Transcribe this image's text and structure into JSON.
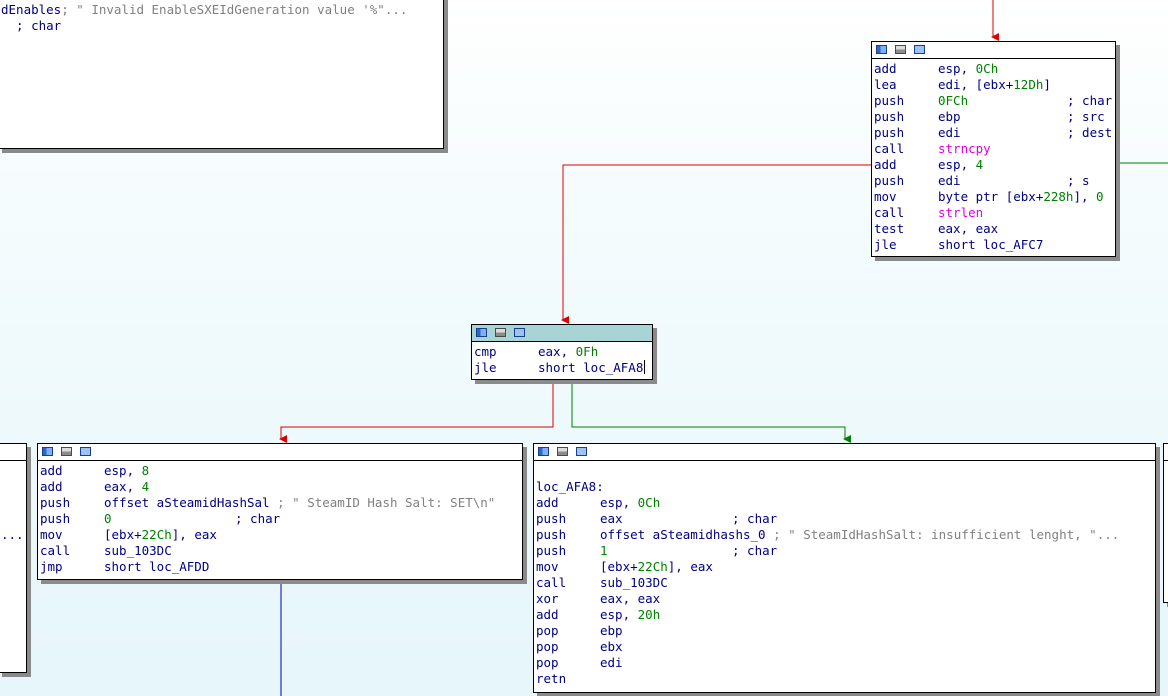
{
  "colors": {
    "true_edge": "#008000",
    "false_edge": "#e00000",
    "jump_edge": "#0000c0",
    "operand": "#000080",
    "number": "#008000",
    "function": "#e000e0",
    "comment": "#808080"
  },
  "nodes": {
    "top_left": {
      "lines": [
        {
          "m": "dEnables",
          "op": "",
          "comment": "; \" Invalid EnableSXEIdGeneration value '%\"..."
        },
        {
          "m": "",
          "op": "",
          "comment": "  ; char"
        }
      ]
    },
    "top_right": {
      "lines": [
        {
          "m": "add",
          "parts": [
            {
              "t": "esp, "
            },
            {
              "t": "0Ch",
              "c": "n"
            }
          ]
        },
        {
          "m": "lea",
          "parts": [
            {
              "t": "edi, [ebx+"
            },
            {
              "t": "12Dh",
              "c": "n"
            },
            {
              "t": "]"
            }
          ]
        },
        {
          "m": "push",
          "parts": [
            {
              "t": "0FCh",
              "c": "n"
            }
          ],
          "comment": "; char"
        },
        {
          "m": "push",
          "parts": [
            {
              "t": "ebp"
            }
          ],
          "comment": "; src"
        },
        {
          "m": "push",
          "parts": [
            {
              "t": "edi"
            }
          ],
          "comment": "; dest"
        },
        {
          "m": "call",
          "parts": [
            {
              "t": "strncpy",
              "c": "f"
            }
          ]
        },
        {
          "m": "add",
          "parts": [
            {
              "t": "esp, "
            },
            {
              "t": "4",
              "c": "n"
            }
          ]
        },
        {
          "m": "push",
          "parts": [
            {
              "t": "edi"
            }
          ],
          "comment": "; s"
        },
        {
          "m": "mov",
          "parts": [
            {
              "t": "byte ptr [ebx+"
            },
            {
              "t": "228h",
              "c": "n"
            },
            {
              "t": "], "
            },
            {
              "t": "0",
              "c": "n"
            }
          ]
        },
        {
          "m": "call",
          "parts": [
            {
              "t": "strlen",
              "c": "f"
            }
          ]
        },
        {
          "m": "test",
          "parts": [
            {
              "t": "eax, eax"
            }
          ]
        },
        {
          "m": "jle",
          "parts": [
            {
              "t": "short loc_AFC7"
            }
          ]
        }
      ]
    },
    "middle": {
      "lines": [
        {
          "m": "cmp",
          "parts": [
            {
              "t": "eax, "
            },
            {
              "t": "0Fh",
              "c": "n"
            }
          ]
        },
        {
          "m": "jle",
          "parts": [
            {
              "t": "short loc_AFA8"
            }
          ]
        }
      ]
    },
    "bottom_left": {
      "lines": [
        {
          "m": "add",
          "parts": [
            {
              "t": "esp, "
            },
            {
              "t": "8",
              "c": "n"
            }
          ]
        },
        {
          "m": "add",
          "parts": [
            {
              "t": "eax, "
            },
            {
              "t": "4",
              "c": "n"
            }
          ]
        },
        {
          "m": "push",
          "parts": [
            {
              "t": "offset aSteamidHashSal "
            }
          ],
          "comment": "; \" SteamID Hash Salt: SET\\n\""
        },
        {
          "m": "push",
          "parts": [
            {
              "t": "0",
              "c": "n"
            }
          ],
          "comment": "; char"
        },
        {
          "m": "mov",
          "parts": [
            {
              "t": "[ebx+"
            },
            {
              "t": "22Ch",
              "c": "n"
            },
            {
              "t": "], eax"
            }
          ]
        },
        {
          "m": "call",
          "parts": [
            {
              "t": "sub_103DC"
            }
          ]
        },
        {
          "m": "jmp",
          "parts": [
            {
              "t": "short loc_AFDD"
            }
          ]
        }
      ]
    },
    "bottom_right": {
      "lines": [
        {
          "m": "",
          "parts": []
        },
        {
          "m": "loc_AFA8:",
          "parts": []
        },
        {
          "m": "add",
          "parts": [
            {
              "t": "esp, "
            },
            {
              "t": "0Ch",
              "c": "n"
            }
          ]
        },
        {
          "m": "push",
          "parts": [
            {
              "t": "eax"
            }
          ],
          "comment": "; char"
        },
        {
          "m": "push",
          "parts": [
            {
              "t": "offset aSteamidhashs_0 "
            }
          ],
          "comment": "; \" SteamIdHashSalt: insufficient lenght, \"..."
        },
        {
          "m": "push",
          "parts": [
            {
              "t": "1",
              "c": "n"
            }
          ],
          "comment": "; char"
        },
        {
          "m": "mov",
          "parts": [
            {
              "t": "[ebx+"
            },
            {
              "t": "22Ch",
              "c": "n"
            },
            {
              "t": "], eax"
            }
          ]
        },
        {
          "m": "call",
          "parts": [
            {
              "t": "sub_103DC"
            }
          ]
        },
        {
          "m": "xor",
          "parts": [
            {
              "t": "eax, eax"
            }
          ]
        },
        {
          "m": "add",
          "parts": [
            {
              "t": "esp, "
            },
            {
              "t": "20h",
              "c": "n"
            }
          ]
        },
        {
          "m": "pop",
          "parts": [
            {
              "t": "ebp"
            }
          ]
        },
        {
          "m": "pop",
          "parts": [
            {
              "t": "ebx"
            }
          ]
        },
        {
          "m": "pop",
          "parts": [
            {
              "t": "edi"
            }
          ]
        },
        {
          "m": "retn",
          "parts": []
        }
      ]
    },
    "left_partial": {
      "lines": [
        {
          "m": "",
          "parts": []
        },
        {
          "m": "",
          "parts": []
        },
        {
          "m": "",
          "parts": []
        },
        {
          "m": "",
          "parts": []
        },
        {
          "m": "...",
          "parts": []
        }
      ]
    }
  }
}
